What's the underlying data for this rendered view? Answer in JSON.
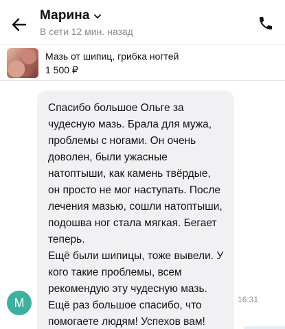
{
  "header": {
    "contact_name": "Марина",
    "last_seen": "В сети 12 мин. назад"
  },
  "listing": {
    "title": "Мазь от шипиц, грибка ногтей",
    "price": "1 500 ₽"
  },
  "chat": {
    "avatar_letter": "М",
    "avatar_color": "#3fb0a0",
    "message": {
      "text": "Спасибо большое Ольге за\nчудесную мазь. Брала для мужа,\nпроблемы с ногами. Он очень\nдоволен, были ужасные\nнатоптыши, как камень твёрдые,\nон просто не мог наступать. После\nлечения мазью, сошли натоптыши,\nподошва ног стала мягкая. Бегает\nтеперь.\nЕщё были шипицы, тоже вывели. У\nкого такие проблемы, всем\nрекомендую эту чудесную мазь.\nЕщё раз большое спасибо, что\nпомогаете людям! Успехов вам!",
      "time": "16:31"
    }
  },
  "icons": {
    "back": "arrow-left-icon",
    "chevron": "chevron-down-icon",
    "call": "phone-icon"
  },
  "colors": {
    "bubble_bg": "#f1f1f3",
    "muted_text": "#8a8a8a"
  }
}
